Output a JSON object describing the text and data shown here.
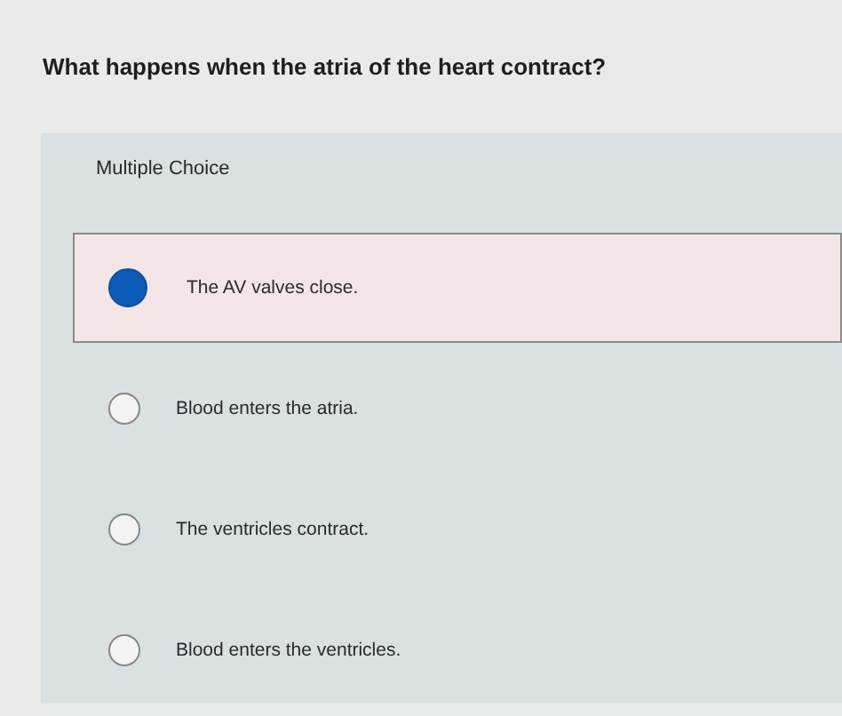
{
  "question": "What happens when the atria of the heart contract?",
  "question_type": "Multiple Choice",
  "options": [
    {
      "label": "The AV valves close.",
      "selected": true
    },
    {
      "label": "Blood enters the atria.",
      "selected": false
    },
    {
      "label": "The ventricles contract.",
      "selected": false
    },
    {
      "label": "Blood enters the ventricles.",
      "selected": false
    }
  ]
}
